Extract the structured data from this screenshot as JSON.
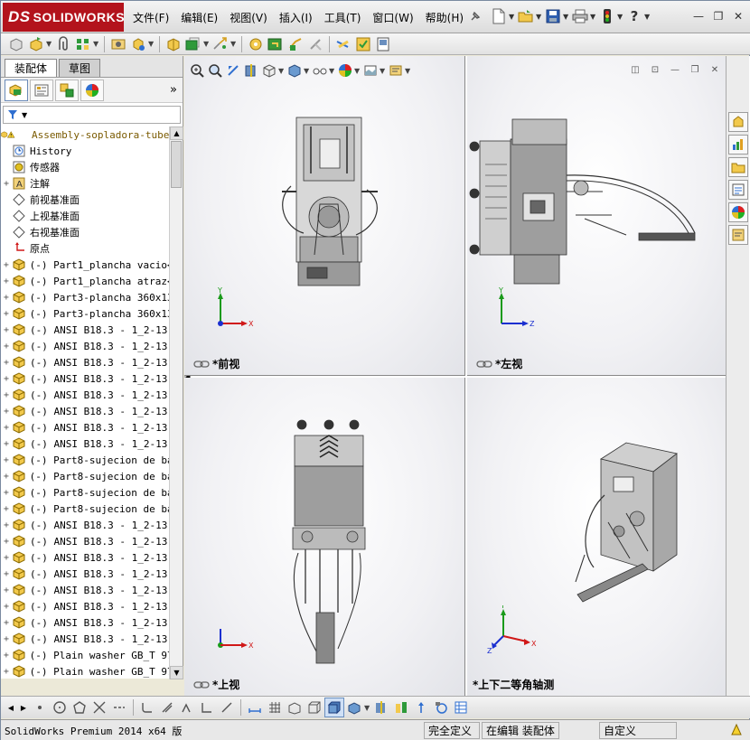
{
  "app": {
    "logo_ds": "DS",
    "logo_text": "SOLIDWORKS"
  },
  "menu": [
    "文件(F)",
    "编辑(E)",
    "视图(V)",
    "插入(I)",
    "工具(T)",
    "窗口(W)",
    "帮助(H)"
  ],
  "quick_help_label": "?",
  "window_controls": {
    "minimize": "—",
    "restore": "❐",
    "close": "✕"
  },
  "tabs": {
    "assembly": "装配体",
    "sketch": "草图"
  },
  "feature_tree": {
    "root": "Assembly-sopladora-tube",
    "items": [
      {
        "label": "History",
        "icon": "history-icon",
        "expand": ""
      },
      {
        "label": "传感器",
        "icon": "sensor-icon",
        "expand": ""
      },
      {
        "label": "注解",
        "icon": "annotation-icon",
        "expand": "+"
      },
      {
        "label": "前视基准面",
        "icon": "plane-icon",
        "expand": ""
      },
      {
        "label": "上视基准面",
        "icon": "plane-icon",
        "expand": ""
      },
      {
        "label": "右视基准面",
        "icon": "plane-icon",
        "expand": ""
      },
      {
        "label": "原点",
        "icon": "origin-icon",
        "expand": ""
      },
      {
        "label": "(-) Part1_plancha vacio<",
        "icon": "part-icon",
        "expand": "+"
      },
      {
        "label": "(-) Part1_plancha atraz<",
        "icon": "part-icon",
        "expand": "+"
      },
      {
        "label": "(-) Part3-plancha 360x13",
        "icon": "part-icon",
        "expand": "+"
      },
      {
        "label": "(-) Part3-plancha 360x13",
        "icon": "part-icon",
        "expand": "+"
      },
      {
        "label": "(-) ANSI B18.3 - 1_2-13",
        "icon": "part-icon",
        "expand": "+"
      },
      {
        "label": "(-) ANSI B18.3 - 1_2-13",
        "icon": "part-icon",
        "expand": "+"
      },
      {
        "label": "(-) ANSI B18.3 - 1_2-13",
        "icon": "part-icon",
        "expand": "+"
      },
      {
        "label": "(-) ANSI B18.3 - 1_2-13",
        "icon": "part-icon",
        "expand": "+"
      },
      {
        "label": "(-) ANSI B18.3 - 1_2-13",
        "icon": "part-icon",
        "expand": "+"
      },
      {
        "label": "(-) ANSI B18.3 - 1_2-13",
        "icon": "part-icon",
        "expand": "+"
      },
      {
        "label": "(-) ANSI B18.3 - 1_2-13",
        "icon": "part-icon",
        "expand": "+"
      },
      {
        "label": "(-) ANSI B18.3 - 1_2-13",
        "icon": "part-icon",
        "expand": "+"
      },
      {
        "label": "(-) Part8-sujecion de ba",
        "icon": "part-icon",
        "expand": "+"
      },
      {
        "label": "(-) Part8-sujecion de ba",
        "icon": "part-icon",
        "expand": "+"
      },
      {
        "label": "(-) Part8-sujecion de ba",
        "icon": "part-icon",
        "expand": "+"
      },
      {
        "label": "(-) Part8-sujecion de ba",
        "icon": "part-icon",
        "expand": "+"
      },
      {
        "label": "(-) ANSI B18.3 - 1_2-13",
        "icon": "part-icon",
        "expand": "+"
      },
      {
        "label": "(-) ANSI B18.3 - 1_2-13",
        "icon": "part-icon",
        "expand": "+"
      },
      {
        "label": "(-) ANSI B18.3 - 1_2-13",
        "icon": "part-icon",
        "expand": "+"
      },
      {
        "label": "(-) ANSI B18.3 - 1_2-13",
        "icon": "part-icon",
        "expand": "+"
      },
      {
        "label": "(-) ANSI B18.3 - 1_2-13",
        "icon": "part-icon",
        "expand": "+"
      },
      {
        "label": "(-) ANSI B18.3 - 1_2-13",
        "icon": "part-icon",
        "expand": "+"
      },
      {
        "label": "(-) ANSI B18.3 - 1_2-13",
        "icon": "part-icon",
        "expand": "+"
      },
      {
        "label": "(-) ANSI B18.3 - 1_2-13",
        "icon": "part-icon",
        "expand": "+"
      },
      {
        "label": "(-) Plain washer GB_T 97",
        "icon": "part-icon",
        "expand": "+"
      },
      {
        "label": "(-) Plain washer GB_T 97",
        "icon": "part-icon",
        "expand": "+"
      }
    ]
  },
  "viewports": {
    "front": "*前视",
    "left": "*左视",
    "top": "*上视",
    "iso": "*上下二等角轴测"
  },
  "axes": {
    "x": "X",
    "y": "Y",
    "z": "Z"
  },
  "status": {
    "product": "SolidWorks Premium 2014 x64 版",
    "underdefined": "完全定义",
    "editing": "在编辑 装配体",
    "custom": "自定义"
  },
  "colors": {
    "brand": "#b3131c",
    "axis_x": "#d01818",
    "axis_y": "#1a9a1a",
    "axis_z": "#1a2fd0"
  }
}
